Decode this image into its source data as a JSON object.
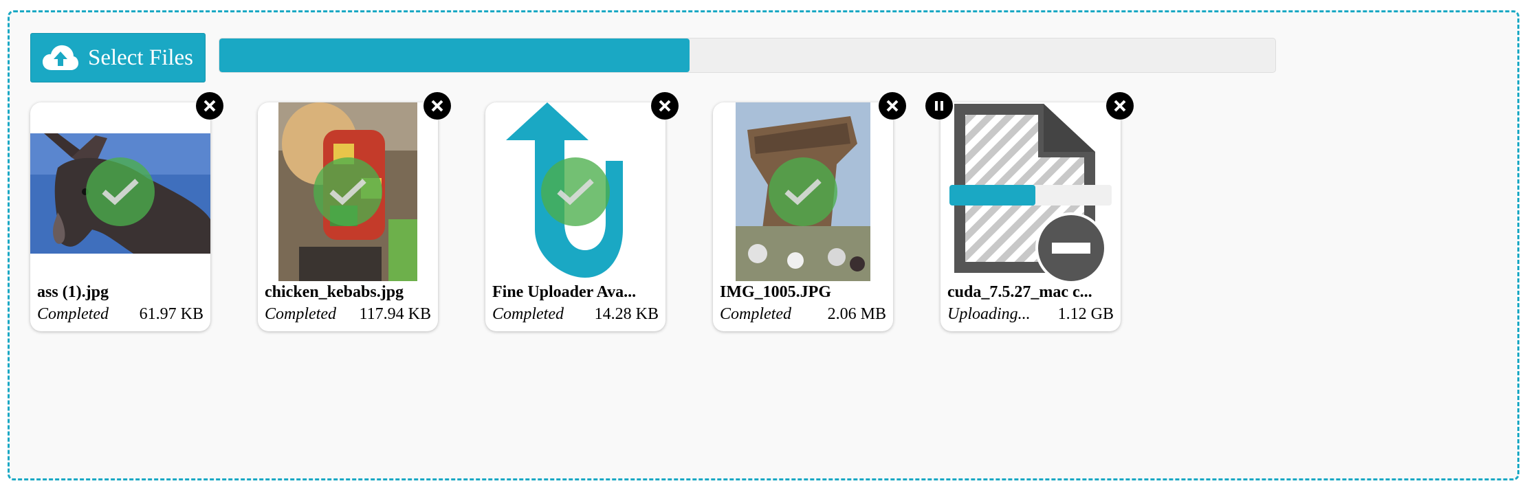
{
  "toolbar": {
    "select_label": "Select Files",
    "upload_icon": "cloud-upload-icon"
  },
  "total_progress": {
    "percent": 44.5
  },
  "files": [
    {
      "name": "ass (1).jpg",
      "status": "Completed",
      "size": "61.97 KB"
    },
    {
      "name": "chicken_kebabs.jpg",
      "status": "Completed",
      "size": "117.94 KB"
    },
    {
      "name": "Fine Uploader Ava...",
      "status": "Completed",
      "size": "14.28 KB"
    },
    {
      "name": "IMG_1005.JPG",
      "status": "Completed",
      "size": "2.06 MB"
    },
    {
      "name": "cuda_7.5.27_mac c...",
      "status": "Uploading...",
      "size": "1.12 GB",
      "progress_percent": 53
    }
  ],
  "colors": {
    "accent": "#1aa8c4",
    "success": "#4cae4c",
    "dark_icon": "#555555"
  }
}
